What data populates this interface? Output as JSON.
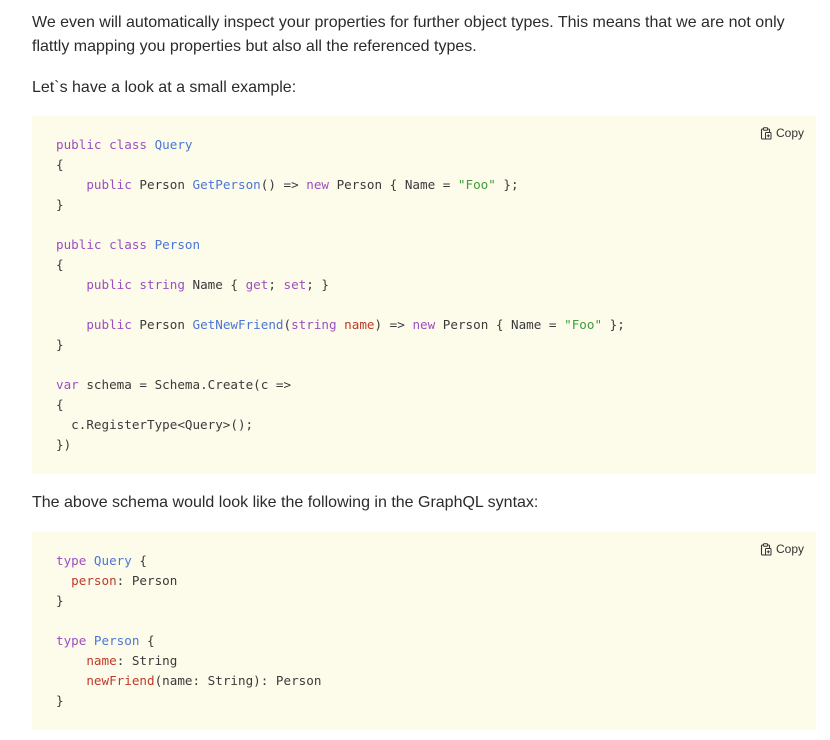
{
  "paragraphs": {
    "intro": "We even will automatically inspect your properties for further object types. This means that we are not only flattly mapping you properties but also all the referenced types.",
    "example": "Let`s have a look at a small example:",
    "schema_note": "The above schema would look like the following in the GraphQL syntax:"
  },
  "code_blocks": [
    {
      "copy_label": "Copy",
      "copy_icon": "clipboard-icon",
      "lines": [
        [
          [
            "kw",
            "public class "
          ],
          [
            "ty",
            "Query"
          ]
        ],
        [
          [
            "op",
            "{"
          ]
        ],
        [
          [
            "op",
            "    "
          ],
          [
            "kw",
            "public "
          ],
          [
            "op",
            "Person "
          ],
          [
            "fn",
            "GetPerson"
          ],
          [
            "op",
            "() => "
          ],
          [
            "kw",
            "new "
          ],
          [
            "op",
            "Person { Name = "
          ],
          [
            "st",
            "\"Foo\""
          ],
          [
            "op",
            " };"
          ]
        ],
        [
          [
            "op",
            "}"
          ]
        ],
        [],
        [
          [
            "kw",
            "public class "
          ],
          [
            "ty",
            "Person"
          ]
        ],
        [
          [
            "op",
            "{"
          ]
        ],
        [
          [
            "op",
            "    "
          ],
          [
            "kw",
            "public string "
          ],
          [
            "op",
            "Name { "
          ],
          [
            "kw",
            "get"
          ],
          [
            "op",
            "; "
          ],
          [
            "kw",
            "set"
          ],
          [
            "op",
            "; }"
          ]
        ],
        [],
        [
          [
            "op",
            "    "
          ],
          [
            "kw",
            "public "
          ],
          [
            "op",
            "Person "
          ],
          [
            "fn",
            "GetNewFriend"
          ],
          [
            "op",
            "("
          ],
          [
            "kw",
            "string "
          ],
          [
            "pr",
            "name"
          ],
          [
            "op",
            ") => "
          ],
          [
            "kw",
            "new "
          ],
          [
            "op",
            "Person { Name = "
          ],
          [
            "st",
            "\"Foo\""
          ],
          [
            "op",
            " };"
          ]
        ],
        [
          [
            "op",
            "}"
          ]
        ],
        [],
        [
          [
            "kw",
            "var "
          ],
          [
            "op",
            "schema = Schema.Create(c =>"
          ]
        ],
        [
          [
            "op",
            "{"
          ]
        ],
        [
          [
            "op",
            "  c.RegisterType<Query>();"
          ]
        ],
        [
          [
            "op",
            "})"
          ]
        ]
      ]
    },
    {
      "copy_label": "Copy",
      "copy_icon": "clipboard-icon",
      "lines": [
        [
          [
            "kw",
            "type "
          ],
          [
            "ty",
            "Query"
          ],
          [
            "op",
            " {"
          ]
        ],
        [
          [
            "op",
            "  "
          ],
          [
            "pr",
            "person"
          ],
          [
            "op",
            ": Person"
          ]
        ],
        [
          [
            "op",
            "}"
          ]
        ],
        [],
        [
          [
            "kw",
            "type "
          ],
          [
            "ty",
            "Person"
          ],
          [
            "op",
            " {"
          ]
        ],
        [
          [
            "op",
            "    "
          ],
          [
            "pr",
            "name"
          ],
          [
            "op",
            ": String"
          ]
        ],
        [
          [
            "op",
            "    "
          ],
          [
            "pr",
            "newFriend"
          ],
          [
            "op",
            "(name: String): Person"
          ]
        ],
        [
          [
            "op",
            "}"
          ]
        ]
      ]
    }
  ],
  "colors": {
    "keyword": "#9b4fc0",
    "type": "#4b76d6",
    "string": "#3f9b3c",
    "property": "#c0392b",
    "code_background": "#fdfbea"
  }
}
